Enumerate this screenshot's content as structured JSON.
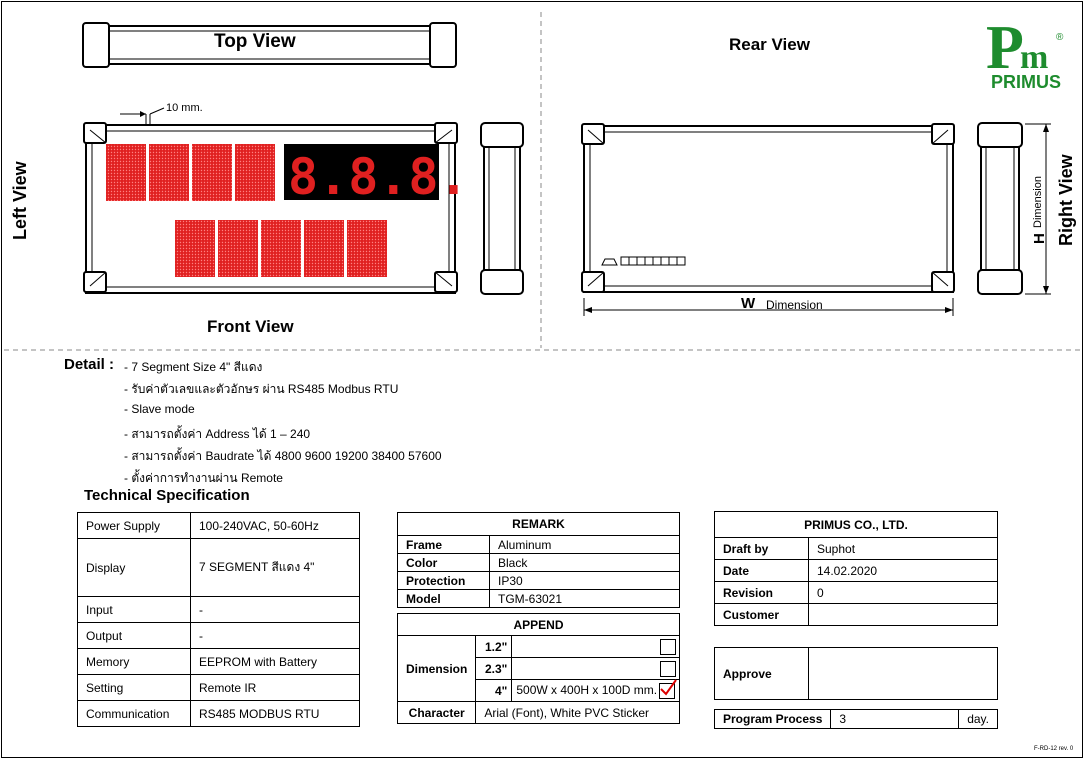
{
  "views": {
    "top": "Top View",
    "rear": "Rear View",
    "left": "Left View",
    "right": "Right View",
    "front": "Front View"
  },
  "drawing": {
    "dim_10mm": "10 mm.",
    "w_letter": "W",
    "w_word": "Dimension",
    "h_letter": "H",
    "h_word": "Dimension",
    "segment_color": "#e02020",
    "matrix_color": "#e02020"
  },
  "logo": {
    "mark": "Pm",
    "reg": "®",
    "name": "PRIMUS",
    "color": "#1e8c2e"
  },
  "detail": {
    "label": "Detail :",
    "lines": [
      "- 7 Segment Size 4\" สีแดง",
      "- รับค่าตัวเลขและตัวอักษร ผ่าน RS485 Modbus RTU",
      "- Slave mode",
      "- สามารถตั้งค่า Address ได้ 1 – 240",
      "- สามารถตั้งค่า Baudrate ได้ 4800 9600 19200 38400 57600",
      "- ตั้งค่าการทำงานผ่าน Remote"
    ]
  },
  "tech": {
    "title": "Technical Specification",
    "rows": [
      {
        "k": "Power Supply",
        "v": "100-240VAC, 50-60Hz"
      },
      {
        "k": "Display",
        "v": "7 SEGMENT สีแดง 4\""
      },
      {
        "k": "Input",
        "v": "-"
      },
      {
        "k": "Output",
        "v": "-"
      },
      {
        "k": "Memory",
        "v": "EEPROM with Battery"
      },
      {
        "k": "Setting",
        "v": "Remote IR"
      },
      {
        "k": "Communication",
        "v": "RS485 MODBUS RTU"
      }
    ]
  },
  "remark": {
    "title": "REMARK",
    "rows": [
      {
        "k": "Frame",
        "v": "Aluminum"
      },
      {
        "k": "Color",
        "v": "Black"
      },
      {
        "k": "Protection",
        "v": "IP30"
      },
      {
        "k": "Model",
        "v": "TGM-63021"
      }
    ]
  },
  "append": {
    "title": "APPEND",
    "dimension_label": "Dimension",
    "sizes": [
      {
        "size": "1.2\"",
        "desc": "",
        "checked": false
      },
      {
        "size": "2.3\"",
        "desc": "",
        "checked": false
      },
      {
        "size": "4\"",
        "desc": "500W x 400H x 100D mm.",
        "checked": true
      }
    ],
    "character_label": "Character",
    "character_value": "Arial (Font), White PVC Sticker"
  },
  "company": {
    "title": "PRIMUS CO., LTD.",
    "rows": [
      {
        "k": "Draft by",
        "v": "Suphot"
      },
      {
        "k": "Date",
        "v": "14.02.2020"
      },
      {
        "k": "Revision",
        "v": "0"
      },
      {
        "k": "Customer",
        "v": ""
      }
    ],
    "approve_label": "Approve",
    "approve_value": "",
    "process_label": "Program Process",
    "process_value": "3",
    "process_unit": "day."
  },
  "form_code": "F-RD-12 rev. 0"
}
